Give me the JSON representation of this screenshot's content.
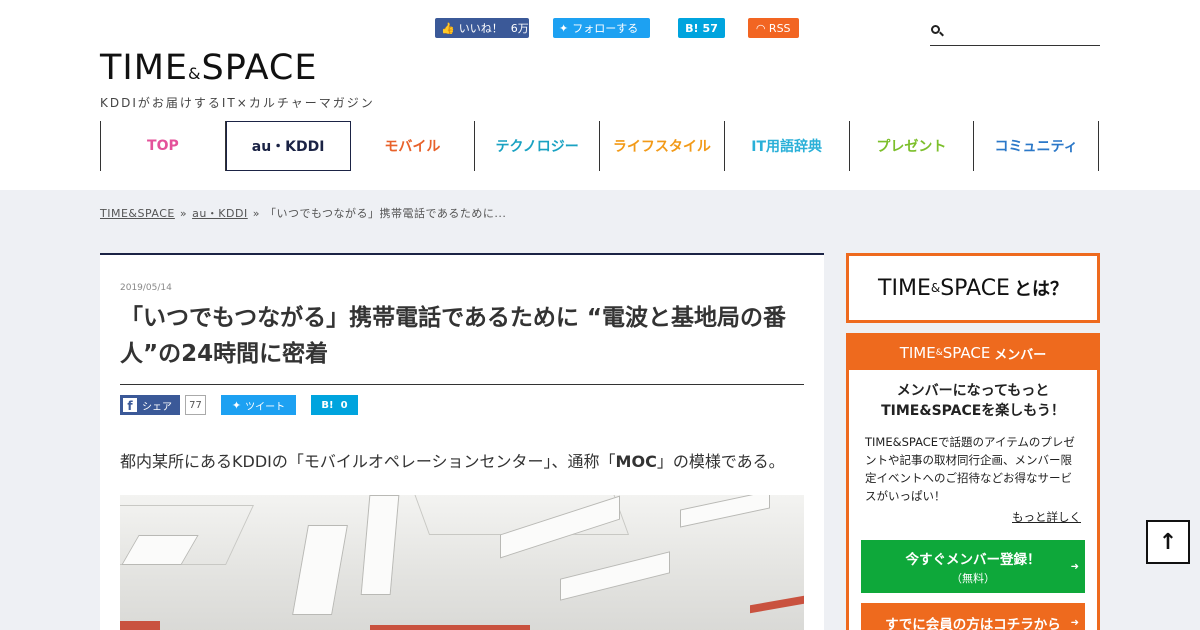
{
  "social": {
    "like_label": "いいね！",
    "like_count": "6万",
    "follow_label": "フォローする",
    "hatena_mark": "B!",
    "hatena_count": "57",
    "rss_label": "RSS"
  },
  "search": {
    "placeholder": ""
  },
  "logo": {
    "main_a": "TIME",
    "amp": "&",
    "main_b": "SPACE",
    "tagline": "KDDIがお届けするIT×カルチャーマガジン"
  },
  "nav": {
    "items": [
      {
        "label": "TOP",
        "color": "#e4519a"
      },
      {
        "label": "au・KDDI",
        "color": "#1b2345"
      },
      {
        "label": "モバイル",
        "color": "#e8612a"
      },
      {
        "label": "テクノロジー",
        "color": "#1aa2c2"
      },
      {
        "label": "ライフスタイル",
        "color": "#f29a18"
      },
      {
        "label": "IT用語辞典",
        "color": "#2ab0d8"
      },
      {
        "label": "プレゼント",
        "color": "#7cbf2a"
      },
      {
        "label": "コミュニティ",
        "color": "#2b78c8"
      }
    ]
  },
  "breadcrumb": {
    "home": "TIME&SPACE",
    "sep1": "»",
    "category": "au・KDDI",
    "sep2": "»",
    "current": "「いつでもつながる」携帯電話であるために..."
  },
  "article": {
    "date": "2019/05/14",
    "title": "「いつでもつながる」携帯電話であるために “電波と基地局の番人”の24時間に密着",
    "share_fb_label": "シェア",
    "share_fb_count": "77",
    "share_tw_label": "ツイート",
    "share_hb_mark": "B!",
    "share_hb_count": "0",
    "lead_a": "都内某所にあるKDDIの「モバイルオペレーションセンター」、通称「",
    "lead_b": "MOC",
    "lead_c": "」の模様である。"
  },
  "sidebar": {
    "about_a": "TIME",
    "about_amp": "&",
    "about_b": "SPACE",
    "about_suffix": "とは？",
    "member_head_a": "TIME",
    "member_head_amp": "&",
    "member_head_b": "SPACE",
    "member_head_suffix": "メンバー",
    "member_title_1": "メンバーになってもっと",
    "member_title_2": "TIME&SPACEを楽しもう！",
    "member_desc": "TIME&SPACEで話題のアイテムのプレゼントや記事の取材同行企画、メンバー限定イベントへのご招待などお得なサービスがいっぱい！",
    "member_more": "もっと詳しく",
    "register_main": "今すぐメンバー登録！",
    "register_sub": "（無料）",
    "login_label": "すでに会員の方はコチラから"
  },
  "to_top": {
    "label": "↑"
  },
  "colors": {
    "accent_orange": "#ee6a1e",
    "navy": "#1b2345",
    "green": "#0ea83a",
    "facebook": "#3b5998",
    "twitter": "#1da1f2",
    "hatena": "#00a4de",
    "rss": "#f26522"
  }
}
